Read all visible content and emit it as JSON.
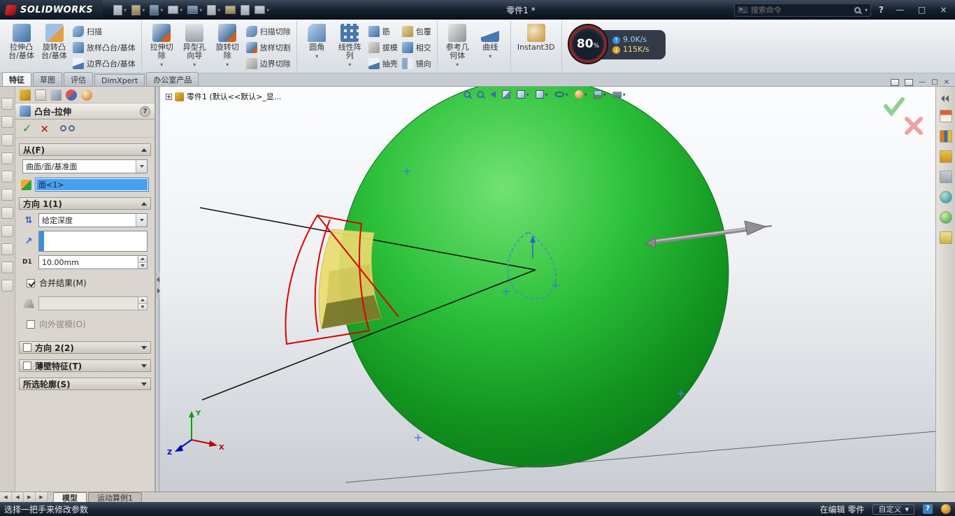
{
  "icons": {
    "chevron_down": "▾",
    "check": "✓",
    "cross": "×",
    "minimize": "—",
    "maximize": "□",
    "close": "×",
    "help": "?",
    "prompt": ">_",
    "prev": "◀",
    "next": "▶",
    "up_arrow": "↑",
    "down_arrow": "↓",
    "reverse_dir": "⇅",
    "direction_arrow": "↗"
  },
  "titlebar": {
    "logo": "SOLIDWORKS",
    "title": "零件1 *",
    "search_placeholder": "搜索命令"
  },
  "net_overlay": {
    "percent": "80",
    "percent_sign": "%",
    "up_speed": "9.0K/s",
    "down_speed": "115K/s"
  },
  "ribbon": {
    "big": [
      "拉伸凸台/基体",
      "旋转凸台/基体",
      "拉伸切除",
      "异型孔向导",
      "旋转切除",
      "圆角",
      "线性阵列",
      "参考几何体",
      "曲线",
      "Instant3D"
    ],
    "small_a": [
      "扫描",
      "放样凸台/基体",
      "边界凸台/基体"
    ],
    "small_b": [
      "扫描切除",
      "放样切割",
      "边界切除"
    ],
    "small_c": [
      "筋",
      "拔模",
      "抽壳"
    ],
    "small_d": [
      "包覆",
      "相交",
      "镜向"
    ]
  },
  "tabs": [
    "特征",
    "草图",
    "评估",
    "DimXpert",
    "办公室产品"
  ],
  "pm": {
    "title": "凸台-拉伸",
    "from_header": "从(F)",
    "from_dropdown": "曲面/面/基准面",
    "from_selection": "面<1>",
    "dir1_header": "方向 1(1)",
    "dir1_end_condition": "给定深度",
    "depth_label": "D1",
    "depth_value": "10.00mm",
    "merge_label": "合并结果(M)",
    "draft_out_label": "向外拔模(O)",
    "dir2_header": "方向 2(2)",
    "thin_header": "薄壁特征(T)",
    "contours_header": "所选轮廓(S)"
  },
  "graphics": {
    "tree_root": "零件1 (默认<<默认>_显...",
    "triad": {
      "x": "X",
      "y": "Y",
      "z": "Z"
    }
  },
  "bottom_tabs": [
    "模型",
    "运动算例1"
  ],
  "statusbar": {
    "message": "选择一把手来修改参数",
    "editing": "在编辑 零件",
    "customize": "自定义"
  },
  "colors": {
    "sphere_green": "#1fae2e",
    "sketch_red": "#e00000",
    "preview_yellow": "#e8dc6e",
    "selection_blue": "#49a0f2",
    "titlebar_dark": "#16202e"
  }
}
